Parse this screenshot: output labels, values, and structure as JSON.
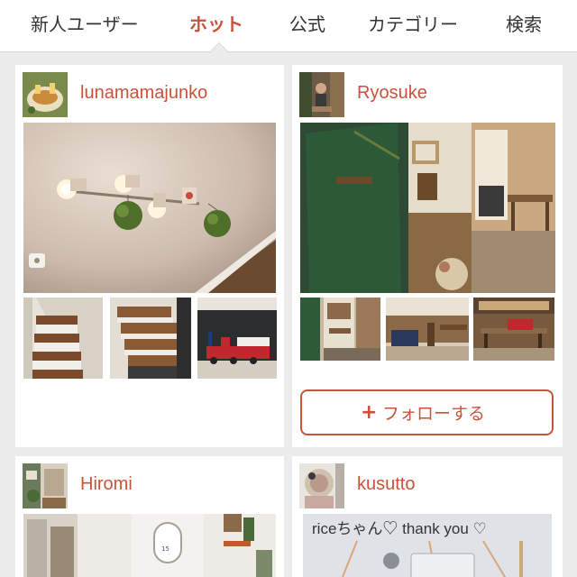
{
  "tabs": [
    {
      "label": "新人ユーザー",
      "active": false
    },
    {
      "label": "ホット",
      "active": true
    },
    {
      "label": "公式",
      "active": false
    },
    {
      "label": "カテゴリー",
      "active": false
    },
    {
      "label": "検索",
      "active": false
    }
  ],
  "colors": {
    "accent": "#c9533a",
    "background": "#ececec",
    "card": "#ffffff"
  },
  "posts": [
    {
      "username": "lunamamajunko",
      "photos": [
        "ceiling spotlights with moss balls",
        "staircase",
        "staircase",
        "toy train on blackboard wall"
      ]
    },
    {
      "username": "Ryosuke",
      "photos": [
        "green door and wooden room",
        "wooden shelf room",
        "living room",
        "room with red box"
      ],
      "follow_label": "フォローする",
      "follow_icon": "plus-icon"
    },
    {
      "username": "Hiromi",
      "photos": [
        "white shelf with clock"
      ],
      "clock_text": "15"
    },
    {
      "username": "kusutto",
      "photos": [
        "note on wall"
      ],
      "photo_caption": "riceちゃん♡ thank you ♡"
    }
  ]
}
